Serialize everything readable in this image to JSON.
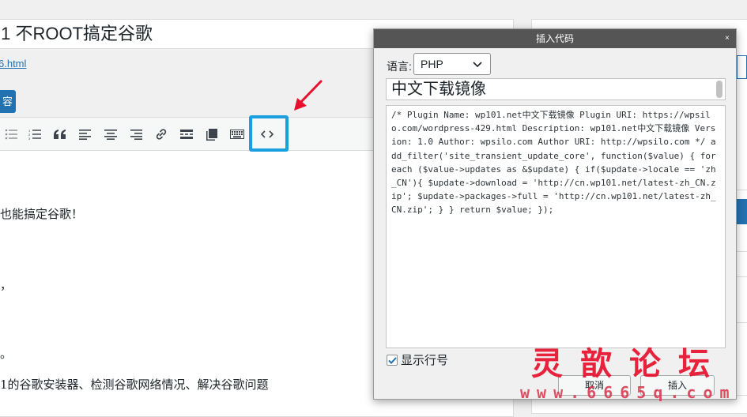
{
  "editor": {
    "post_title": ".1 不ROOT搞定谷歌",
    "permalink_fragment": "6.html",
    "add_media_label": "容",
    "content_lines": [
      "也能搞定谷歌！",
      "，",
      "。",
      "1的谷歌安装器、检测谷歌网络情况、解决谷歌问题"
    ],
    "toolbar_icons": [
      "bullet-list-icon",
      "numbered-list-icon",
      "blockquote-icon",
      "align-left-icon",
      "align-center-icon",
      "align-right-icon",
      "link-icon",
      "read-more-icon",
      "toolbar-toggle-icon",
      "keyboard-icon",
      "code-icon"
    ]
  },
  "dialog": {
    "title": "插入代码",
    "close_label": "×",
    "language_label": "语言:",
    "language_value": "PHP",
    "snippet_title": "中文下载镜像",
    "code": "/* Plugin Name: wp101.net中文下载镜像 Plugin URI: https://wpsilo.com/wordpress-429.html Description: wp101.net中文下载镜像 Version: 1.0 Author: wpsilo.com Author URI: http://wpsilo.com */ add_filter('site_transient_update_core', function($value) { foreach ($value->updates as &$update) { if($update->locale == 'zh_CN'){ $update->download = 'http://cn.wp101.net/latest-zh_CN.zip'; $update->packages->full = 'http://cn.wp101.net/latest-zh_CN.zip'; } } return $value; });",
    "show_line_numbers_label": "显示行号",
    "show_line_numbers": true,
    "cancel_label": "取消",
    "insert_label": "插入"
  },
  "watermark": {
    "chars": "灵歆论坛",
    "url": "www.6665q.com"
  },
  "colors": {
    "accent": "#2271b1",
    "highlight": "#1aa0e0",
    "arrow": "#e8112d"
  }
}
